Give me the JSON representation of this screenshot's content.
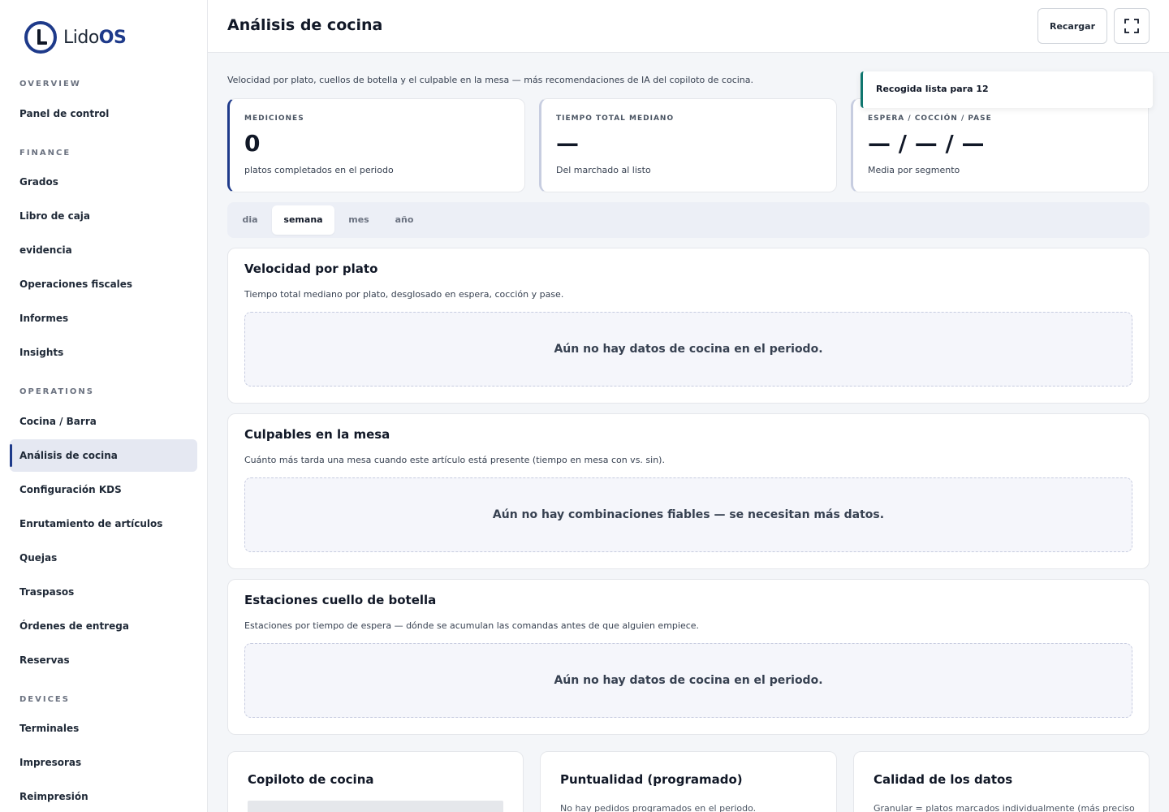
{
  "brand": {
    "name_prefix": "Lido",
    "name_suffix": "OS"
  },
  "sidebar": {
    "sections": [
      {
        "label": "OVERVIEW"
      },
      {
        "label": "FINANCE"
      },
      {
        "label": "OPERATIONS"
      },
      {
        "label": "DEVICES"
      }
    ],
    "items": [
      {
        "label": "Panel de control"
      },
      {
        "label": "Grados"
      },
      {
        "label": "Libro de caja"
      },
      {
        "label": "evidencia"
      },
      {
        "label": "Operaciones fiscales"
      },
      {
        "label": "Informes"
      },
      {
        "label": "Insights"
      },
      {
        "label": "Cocina / Barra"
      },
      {
        "label": "Análisis de cocina",
        "active": true
      },
      {
        "label": "Configuración KDS"
      },
      {
        "label": "Enrutamiento de artículos"
      },
      {
        "label": "Quejas"
      },
      {
        "label": "Traspasos"
      },
      {
        "label": "Órdenes de entrega"
      },
      {
        "label": "Reservas"
      },
      {
        "label": "Terminales"
      },
      {
        "label": "Impresoras"
      },
      {
        "label": "Reimpresión"
      }
    ]
  },
  "header": {
    "title": "Análisis de cocina",
    "reload_label": "Recargar",
    "fullscreen_icon": "expand-icon"
  },
  "subtitle": "Velocidad por plato, cuellos de botella y el culpable en la mesa — más recomendaciones de IA del copiloto de cocina.",
  "toast": {
    "message": "Recogida lista para 12",
    "accent": "#0f766e"
  },
  "stats": [
    {
      "label": "MEDICIONES",
      "value": "0",
      "desc": "platos completados en el periodo"
    },
    {
      "label": "TIEMPO TOTAL MEDIANO",
      "value": "—",
      "desc": "Del marchado al listo"
    },
    {
      "label": "ESPERA / COCCIÓN / PASE",
      "value": "— / — / —",
      "desc": "Media por segmento"
    }
  ],
  "period_tabs": [
    {
      "label": "dia"
    },
    {
      "label": "semana",
      "active": true
    },
    {
      "label": "mes"
    },
    {
      "label": "año"
    }
  ],
  "panels": [
    {
      "title": "Velocidad por plato",
      "desc": "Tiempo total mediano por plato, desglosado en espera, cocción y pase.",
      "empty": "Aún no hay datos de cocina en el periodo."
    },
    {
      "title": "Culpables en la mesa",
      "desc": "Cuánto más tarda una mesa cuando este artículo está presente (tiempo en mesa con vs. sin).",
      "empty": "Aún no hay combinaciones fiables — se necesitan más datos."
    },
    {
      "title": "Estaciones cuello de botella",
      "desc": "Estaciones por tiempo de espera — dónde se acumulan las comandas antes de que alguien empiece.",
      "empty": "Aún no hay datos de cocina en el periodo."
    }
  ],
  "bottom_cards": [
    {
      "title": "Copiloto de cocina",
      "desc": ""
    },
    {
      "title": "Puntualidad (programado)",
      "desc": "No hay pedidos programados en el periodo."
    },
    {
      "title": "Calidad de los datos",
      "desc": "Granular = platos marcados individualmente (más preciso"
    }
  ],
  "colors": {
    "accent": "#1e3a8a",
    "toast": "#0f766e"
  }
}
